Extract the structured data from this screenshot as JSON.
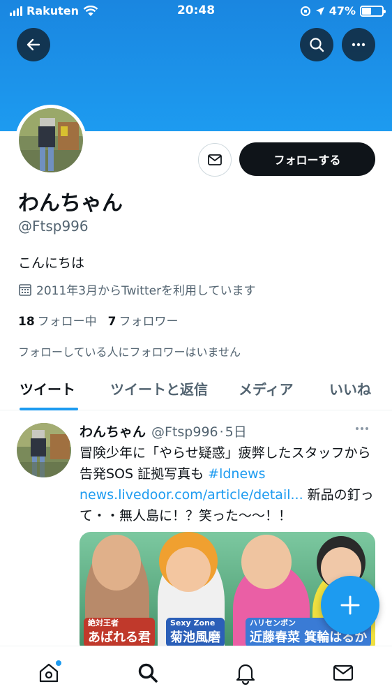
{
  "status_bar": {
    "carrier": "Rakuten",
    "time": "20:48",
    "battery": "47%",
    "battery_level": 0.47
  },
  "nav": {
    "back_icon": "arrow-left-icon",
    "search_icon": "search-icon",
    "more_icon": "more-horizontal-icon"
  },
  "profile": {
    "display_name": "わんちゃん",
    "handle": "@Ftsp996",
    "bio": "こんにちは",
    "joined": "2011年3月からTwitterを利用しています",
    "following_count": "18",
    "following_label": "フォロー中",
    "followers_count": "7",
    "followers_label": "フォロワー",
    "follow_note": "フォローしている人にフォロワーはいません",
    "follow_button": "フォローする",
    "colors": {
      "accent": "#1d9bf0",
      "dark": "#0f1419",
      "muted": "#536471"
    }
  },
  "tabs": [
    {
      "label": "ツイート",
      "active": true
    },
    {
      "label": "ツイートと返信",
      "active": false
    },
    {
      "label": "メディア",
      "active": false
    },
    {
      "label": "いいね",
      "active": false
    }
  ],
  "tweet": {
    "name": "わんちゃん",
    "handle": "@Ftsp996",
    "separator": "·",
    "age": "5日",
    "text_part1": "冒険少年に「やらせ疑惑」疲弊したスタッフから告発SOS 証拠写真も ",
    "hashtag": "#ldnews",
    "link": "news.livedoor.com/article/detail...",
    "text_part2": " 新品の釘って・・無人島に！？笑った〜〜！！",
    "media_captions": [
      {
        "sub": "絶対王者",
        "main": "あばれる君"
      },
      {
        "sub": "Sexy Zone",
        "main": "菊池風磨"
      },
      {
        "sub": "ハリセンボン",
        "main": "近藤春菜 箕輪はるか"
      }
    ]
  },
  "bottom_nav": [
    {
      "icon": "home-icon",
      "badge": true
    },
    {
      "icon": "search-icon",
      "badge": false
    },
    {
      "icon": "bell-icon",
      "badge": false
    },
    {
      "icon": "mail-icon",
      "badge": false
    }
  ]
}
